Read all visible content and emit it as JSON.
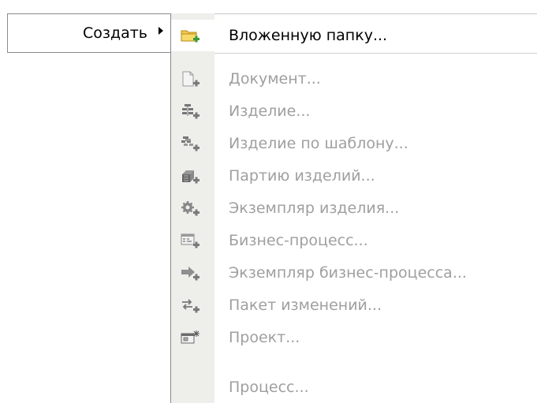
{
  "parent_menu": {
    "label": "Создать"
  },
  "submenu": {
    "items": [
      {
        "label": "Вложенную папку...",
        "icon": "folder-add-icon",
        "enabled": true
      },
      {
        "label": "Документ...",
        "icon": "document-add-icon",
        "enabled": false
      },
      {
        "label": "Изделие...",
        "icon": "product-add-icon",
        "enabled": false
      },
      {
        "label": "Изделие по шаблону...",
        "icon": "product-template-add-icon",
        "enabled": false
      },
      {
        "label": "Партию изделий...",
        "icon": "product-batch-add-icon",
        "enabled": false
      },
      {
        "label": "Экземпляр изделия...",
        "icon": "product-instance-add-icon",
        "enabled": false
      },
      {
        "label": "Бизнес-процесс...",
        "icon": "business-process-add-icon",
        "enabled": false
      },
      {
        "label": "Экземпляр бизнес-процесса...",
        "icon": "business-process-instance-add-icon",
        "enabled": false
      },
      {
        "label": "Пакет изменений...",
        "icon": "change-package-add-icon",
        "enabled": false
      },
      {
        "label": "Проект...",
        "icon": "project-add-icon",
        "enabled": false
      },
      {
        "label": "Процесс...",
        "icon": "",
        "enabled": false
      }
    ]
  },
  "colors": {
    "accent_plus": "#3a9a3a",
    "disabled_text": "#9f9f9f",
    "gutter": "#eeeeeb"
  }
}
